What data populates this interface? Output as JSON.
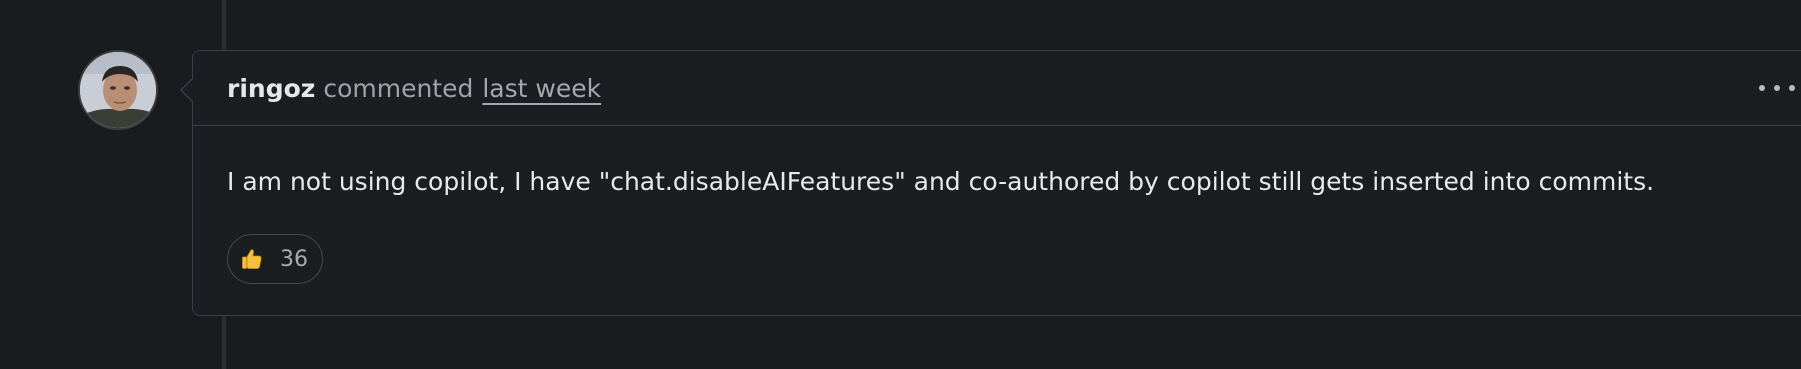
{
  "comment": {
    "author": "ringoz",
    "action": "commented",
    "timestamp": "last week",
    "body": "I am not using copilot, I have \"chat.disableAIFeatures\" and co-authored by copilot still gets inserted into commits.",
    "reactions": [
      {
        "icon": "thumbs-up-icon",
        "count": "36"
      }
    ],
    "menu_icon": "kebab-horizontal-icon",
    "avatar_icon": "user-avatar"
  },
  "colors": {
    "background": "#1a1b1e",
    "border": "#3b3e44",
    "text": "#e8e9eb",
    "muted": "#9da3ab"
  }
}
